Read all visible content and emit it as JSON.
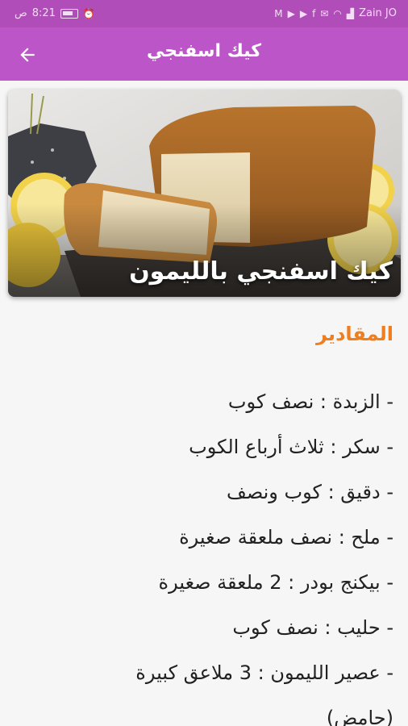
{
  "status_bar": {
    "time": "8:21",
    "am_pm": "ص",
    "carrier": "Zain JO"
  },
  "app_bar": {
    "title": "كيك اسفنجي",
    "back_icon": "arrow-back-icon"
  },
  "hero": {
    "caption": "كيك اسفنجي بالليمون"
  },
  "ingredients": {
    "heading": "المقادير",
    "items": [
      "- الزبدة : نصف كوب",
      "- سكر : ثلاث أرباع الكوب",
      "- دقيق : كوب ونصف",
      "- ملح : نصف ملعقة صغيرة",
      "- بيكنج بودر : 2 ملعقة صغيرة",
      "- حليب : نصف كوب",
      "- عصير الليمون : 3 ملاعق كبيرة",
      "(حامض)"
    ]
  },
  "colors": {
    "status_bar": "#b04db8",
    "app_bar": "#bb55c8",
    "heading": "#ef7f1e"
  }
}
